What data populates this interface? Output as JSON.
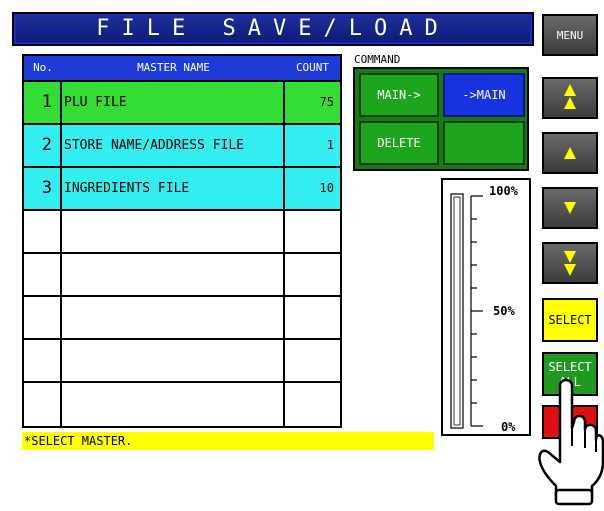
{
  "title": "FILE SAVE/LOAD",
  "table": {
    "headers": {
      "no": "No.",
      "name": "MASTER NAME",
      "count": "COUNT"
    },
    "rows": [
      {
        "no": "1",
        "name": "PLU FILE",
        "count": "75",
        "color": "#33dd33"
      },
      {
        "no": "2",
        "name": "STORE NAME/ADDRESS FILE",
        "count": "1",
        "color": "#33eef0"
      },
      {
        "no": "3",
        "name": "INGREDIENTS FILE",
        "count": "10",
        "color": "#33eef0"
      },
      {
        "no": "",
        "name": "",
        "count": "",
        "color": "#ffffff"
      },
      {
        "no": "",
        "name": "",
        "count": "",
        "color": "#ffffff"
      },
      {
        "no": "",
        "name": "",
        "count": "",
        "color": "#ffffff"
      },
      {
        "no": "",
        "name": "",
        "count": "",
        "color": "#ffffff"
      },
      {
        "no": "",
        "name": "",
        "count": "",
        "color": "#ffffff"
      }
    ]
  },
  "command": {
    "label": "COMMAND",
    "main_to": "MAIN->",
    "to_main": "->MAIN",
    "delete": "DELETE"
  },
  "gauge": {
    "top": "100%",
    "mid": "50%",
    "bottom": "0%",
    "level": 0
  },
  "status": "*SELECT MASTER.",
  "side": {
    "menu": "MENU",
    "page_up_icon": "double-up-arrow",
    "up_icon": "up-arrow",
    "down_icon": "down-arrow",
    "page_down_icon": "double-down-arrow",
    "select": "SELECT",
    "select_all_1": "SELECT",
    "select_all_2": "ALL"
  },
  "colors": {
    "select_yellow": "#ffff00",
    "select_all_green": "#1f9a1f",
    "delete_red": "#e01010"
  }
}
